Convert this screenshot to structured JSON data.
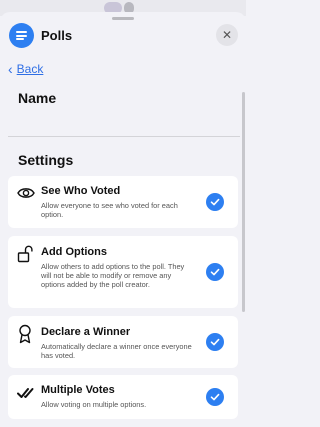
{
  "header": {
    "title": "Polls",
    "close_glyph": "✕",
    "app_icon": "list-icon"
  },
  "nav": {
    "back_label": "Back",
    "back_glyph": "‹"
  },
  "name_section": {
    "title": "Name",
    "value": ""
  },
  "settings": {
    "title": "Settings",
    "options": [
      {
        "title": "See Who Voted",
        "description": "Allow everyone to see who voted for each option.",
        "icon": "eye-icon",
        "checked": true
      },
      {
        "title": "Add Options",
        "description": "Allow others to add options to the poll. They will not be able to modify or remove any options added by the poll creator.",
        "icon": "unlock-icon",
        "checked": true
      },
      {
        "title": "Declare a Winner",
        "description": "Automatically declare a winner once everyone has voted.",
        "icon": "award-icon",
        "checked": true
      },
      {
        "title": "Multiple Votes",
        "description": "Allow voting on multiple options.",
        "icon": "double-check-icon",
        "checked": true
      }
    ]
  },
  "colors": {
    "accent": "#2d7ff1",
    "background": "#f2f2f7",
    "card": "#ffffff"
  }
}
